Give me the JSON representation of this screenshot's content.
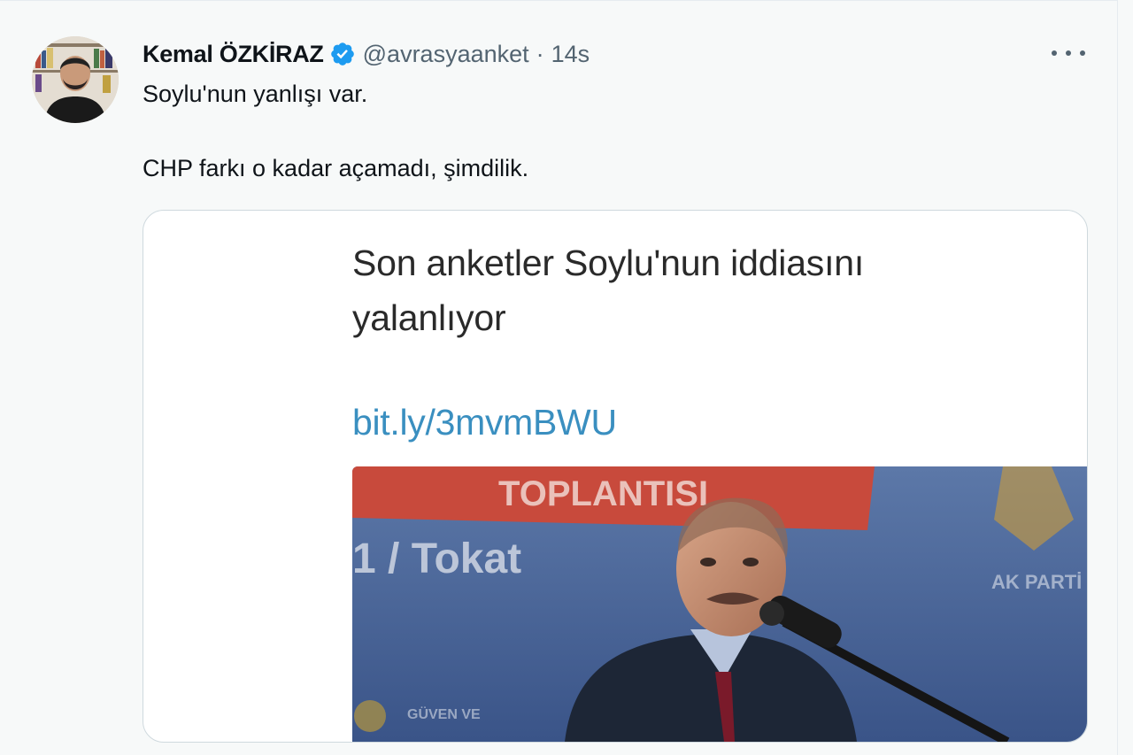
{
  "tweet": {
    "author_name": "Kemal ÖZKİRAZ",
    "handle": "@avrasyaanket",
    "separator": "·",
    "time": "14s",
    "lines": [
      "Soylu'nun yanlışı var.",
      "CHP farkı o kadar açamadı, şimdilik."
    ],
    "verified_icon": "verified-badge-icon",
    "more_icon": "more-options-icon"
  },
  "card": {
    "title_lines": [
      "Son anketler Soylu'nun iddiasını",
      "yalanlıyor"
    ],
    "link": "bit.ly/3mvmBWU",
    "image": {
      "banner_text": "TOPLANTISI",
      "location_text": "1 / Tokat",
      "logo_text": "AK PARTİ",
      "podium_text": "GÜVEN VE"
    }
  },
  "colors": {
    "background": "#f7f9f9",
    "verified": "#1d9bf0",
    "link": "#3a8fc0",
    "secondary_text": "#536471"
  }
}
